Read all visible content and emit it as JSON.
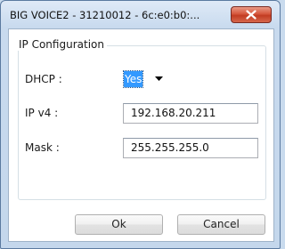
{
  "window": {
    "title": "BIG VOICE2 - 31210012 - 6c:e0:b0:..."
  },
  "group": {
    "legend": "IP Configuration"
  },
  "fields": {
    "dhcp_label": "DHCP :",
    "dhcp_value": "Yes",
    "ipv4_label": "IP v4 :",
    "ipv4_value": "192.168.20.211",
    "mask_label": "Mask :",
    "mask_value": "255.255.255.0"
  },
  "buttons": {
    "ok": "Ok",
    "cancel": "Cancel"
  },
  "icons": {
    "close": "close-icon",
    "dropdown": "chevron-down-icon"
  },
  "colors": {
    "selection": "#3399ff",
    "close_button": "#c9462c"
  }
}
